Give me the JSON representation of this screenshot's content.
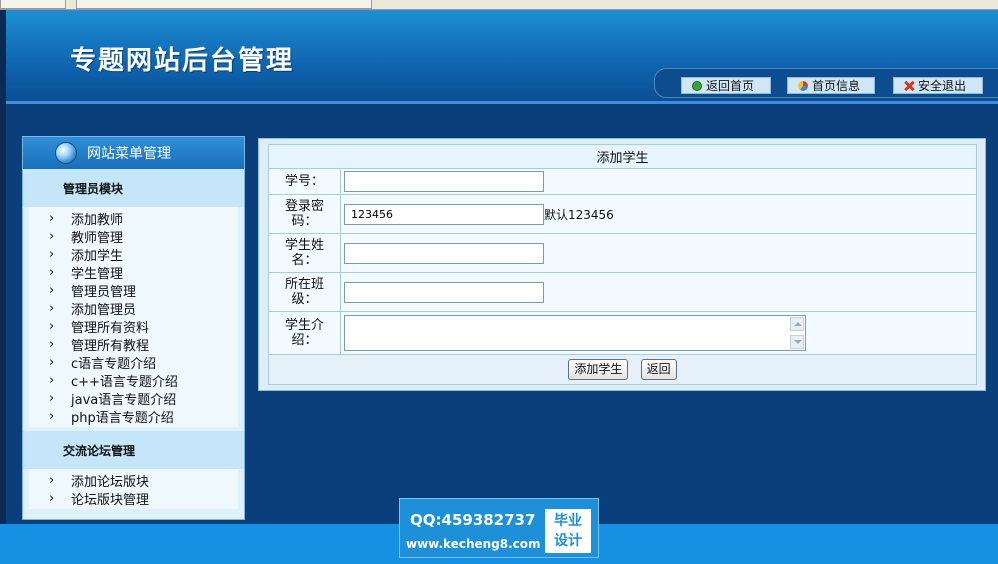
{
  "header": {
    "site_title": "专题网站后台管理",
    "nav": [
      {
        "label": "返回首页",
        "icon": "refresh-icon"
      },
      {
        "label": "首页信息",
        "icon": "pie-chart-icon"
      },
      {
        "label": "安全退出",
        "icon": "close-icon"
      }
    ]
  },
  "sidebar": {
    "title": "网站菜单管理",
    "groups": [
      {
        "title": "管理员模块",
        "items": [
          "添加教师",
          "教师管理",
          "添加学生",
          "学生管理",
          "管理员管理",
          "添加管理员",
          "管理所有资料",
          "管理所有教程",
          "c语言专题介绍",
          "c++语言专题介绍",
          "java语言专题介绍",
          "php语言专题介绍"
        ]
      },
      {
        "title": "交流论坛管理",
        "items": [
          "添加论坛版块",
          "论坛版块管理"
        ]
      }
    ]
  },
  "form": {
    "title": "添加学生",
    "fields": [
      {
        "label": "学号：",
        "value": ""
      },
      {
        "label": "登录密码：",
        "value": "123456",
        "hint": "默认123456"
      },
      {
        "label": "学生姓名：",
        "value": ""
      },
      {
        "label": "所在班级：",
        "value": ""
      },
      {
        "label": "学生介绍：",
        "value": ""
      }
    ],
    "submit_label": "添加学生",
    "back_label": "返回"
  },
  "watermark": {
    "qq": "QQ:459382737",
    "url": "www.kecheng8.com",
    "logo_line1": "毕业",
    "logo_line2": "设计"
  },
  "colors": {
    "header_bg": "#1476bf",
    "body_bg": "#0b3f7c",
    "sidebar_bg": "#dff1fb",
    "panel_bg": "#deeef9",
    "accent": "#1590e3"
  }
}
